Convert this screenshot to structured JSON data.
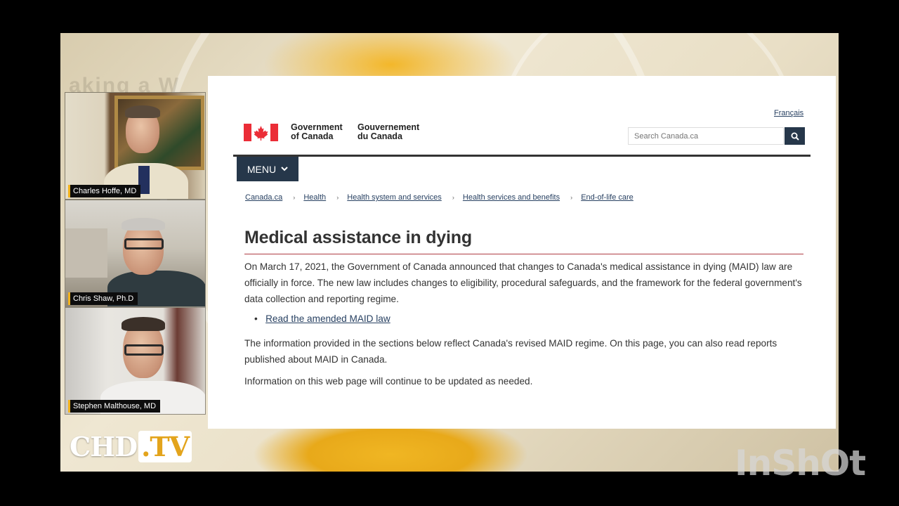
{
  "background": {
    "overlay_text": "aking a W",
    "accent_color": "#f2b21b"
  },
  "speakers": [
    {
      "name": "Charles Hoffe, MD"
    },
    {
      "name": "Chris Shaw, Ph.D"
    },
    {
      "name": "Stephen Malthouse, MD"
    }
  ],
  "logo": {
    "main": "CHD",
    "suffix": ".TV"
  },
  "watermark": {
    "text": "InShOt"
  },
  "webpage": {
    "language_link": "Français",
    "signature": {
      "en_line1": "Government",
      "en_line2": "of Canada",
      "fr_line1": "Gouvernement",
      "fr_line2": "du Canada"
    },
    "search": {
      "placeholder": "Search Canada.ca",
      "icon": "search-icon"
    },
    "menu": {
      "label": "MENU",
      "icon": "chevron-down-icon"
    },
    "breadcrumb": [
      "Canada.ca",
      "Health",
      "Health system and services",
      "Health services and benefits",
      "End-of-life care"
    ],
    "title": "Medical assistance in dying",
    "paragraphs": {
      "p1": "On March 17, 2021, the Government of Canada announced that changes to Canada's medical assistance in dying (MAID) law are officially in force. The new law includes changes to eligibility, procedural safeguards, and the framework for the federal government's data collection and reporting regime.",
      "link": "Read the amended MAID law",
      "p2": "The information provided in the sections below reflect Canada's revised MAID regime. On this page, you can also read reports published about MAID in Canada.",
      "p3": "Information on this web page will continue to be updated as needed."
    },
    "colors": {
      "navy": "#26374a",
      "link": "#284162",
      "title_rule": "#af3c43",
      "flag_red": "#eb2d37"
    }
  }
}
